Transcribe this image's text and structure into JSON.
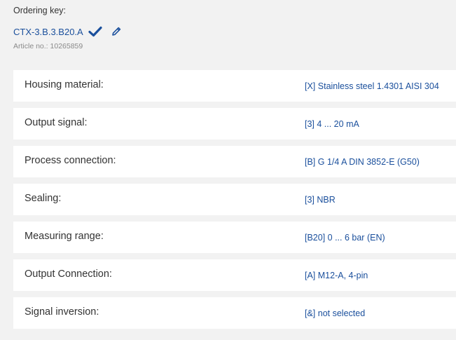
{
  "header": {
    "ordering_label": "Ordering key:",
    "ordering_key": "CTX-3.B.3.B20.A",
    "article_no": "Article no.: 10265859",
    "accent_color": "#1a4f9c"
  },
  "rows": [
    {
      "label": "Housing material:",
      "value": "[X] Stainless steel 1.4301 AISI 304"
    },
    {
      "label": "Output signal:",
      "value": "[3] 4 ... 20 mA"
    },
    {
      "label": "Process connection:",
      "value": "[B] G 1/4 A DIN 3852-E (G50)"
    },
    {
      "label": "Sealing:",
      "value": "[3] NBR"
    },
    {
      "label": "Measuring range:",
      "value": "[B20] 0 ... 6 bar (EN)"
    },
    {
      "label": "Output Connection:",
      "value": "[A] M12-A, 4-pin"
    },
    {
      "label": "Signal inversion:",
      "value": "[&] not selected"
    }
  ],
  "icons": {
    "confirm": "checkmark-icon",
    "edit": "pencil-icon"
  }
}
